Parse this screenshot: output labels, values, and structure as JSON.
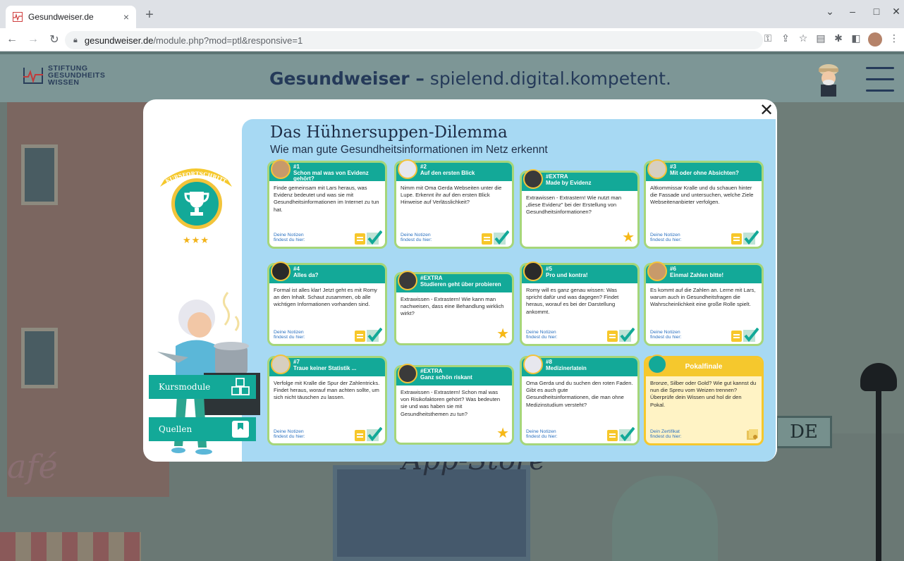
{
  "browser": {
    "tab_title": "Gesundweiser.de",
    "tab_close": "×",
    "new_tab": "+",
    "url_host": "gesundweiser.de",
    "url_path": "/module.php?mod=ptl&responsive=1",
    "window_controls": [
      "⌄",
      "–",
      "□",
      "✕"
    ]
  },
  "site": {
    "logo_lines": [
      "STIFTUNG",
      "GESUNDHEITS",
      "WISSEN"
    ],
    "title_brand": "Gesundweiser –",
    "title_tagline": " spielend.digital.kompetent."
  },
  "background": {
    "cafe_text": "afé",
    "appstore_text": "App-Store",
    "sign_text": "DE"
  },
  "modal": {
    "close": "✕",
    "title": "Das Hühnersuppen-Dilemma",
    "subtitle": "Wie man gute Gesundheitsinformationen im Netz erkennt",
    "progress_ribbon": "KURSFORTSCHRITT",
    "stars": "★★★",
    "kursmodule_label": "Kursmodule",
    "quellen_label": "Quellen",
    "notes_label": "Deine Notizen findest du hier:",
    "cert_label": "Dein Zertifikat findest du hier:",
    "cards": [
      {
        "num": "#1",
        "title": "Schon mal was von Evidenz gehört?",
        "text": "Finde gemeinsam mit Lars heraus, was Evidenz bedeutet und was sie mit Gesundheitsinformationen im Internet zu tun hat."
      },
      {
        "num": "#2",
        "title": "Auf den ersten Blick",
        "text": "Nimm mit Oma Gerda Webseiten unter die Lupe. Erkennt ihr auf den ersten Blick Hinweise auf Verlässlichkeit?"
      },
      {
        "num": "#EXTRA",
        "title": "Made by Evidenz",
        "text": "Extrawissen - Extrastern! Wie nutzt man „diese Evidenz\" bei der Erstellung von Gesundheitsinformationen?"
      },
      {
        "num": "#3",
        "title": "Mit oder ohne Absichten?",
        "text": "Altkommissar Kralle und du schauen hinter die Fassade und untersuchen, welche Ziele Webseitenanbieter verfolgen."
      },
      {
        "num": "#4",
        "title": "Alles da?",
        "text": "Formal ist alles klar! Jetzt geht es mit Romy an den Inhalt. Schaut zusammen, ob alle wichtigen Informationen vorhanden sind."
      },
      {
        "num": "#EXTRA",
        "title": "Studieren geht über probieren",
        "text": "Extrawissen - Extrastern! Wie kann man nachweisen, dass eine Behandlung wirklich wirkt?"
      },
      {
        "num": "#5",
        "title": "Pro und kontra!",
        "text": "Romy will es ganz genau wissen: Was spricht dafür und was dagegen? Findet heraus, worauf es bei der Darstellung ankommt."
      },
      {
        "num": "#6",
        "title": "Einmal Zahlen bitte!",
        "text": "Es kommt auf die Zahlen an. Lerne mit Lars, warum auch in Gesundheitsfragen die Wahrscheinlichkeit eine große Rolle spielt."
      },
      {
        "num": "#7",
        "title": "Traue keiner Statistik ...",
        "text": "Verfolge mit Kralle die Spur der Zahlentricks. Findet heraus, worauf man achten sollte, um sich nicht täuschen zu lassen."
      },
      {
        "num": "#EXTRA",
        "title": "Ganz schön riskant",
        "text": "Extrawissen - Extrastern! Schon mal was von Risikofaktoren gehört? Was bedeuten sie und was haben sie mit Gesundheitsthemen zu tun?"
      },
      {
        "num": "#8",
        "title": "Medizinerlatein",
        "text": "Oma Gerda und du suchen den roten Faden. Gibt es auch gute Gesundheitsinformationen, die man ohne Medizinstudium versteht?"
      },
      {
        "num": "",
        "title": "Pokalfinale",
        "text": "Bronze, Silber oder Gold? Wie gut kannst du nun die Spreu vom Weizen trennen? Überprüfe dein Wissen und hol dir den Pokal."
      }
    ]
  }
}
